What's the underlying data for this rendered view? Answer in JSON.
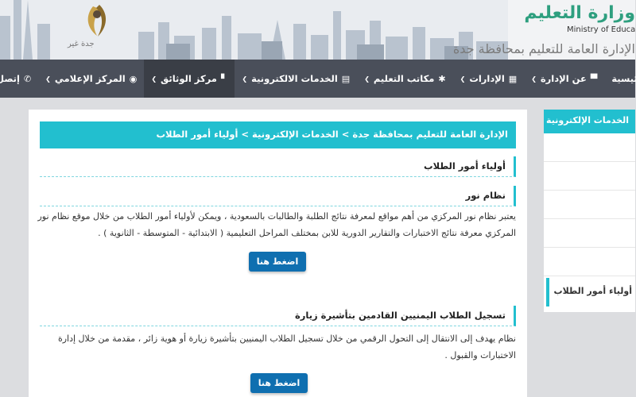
{
  "header": {
    "brand_ar": "وزارة التعليم",
    "brand_en": "Ministry of Education",
    "subtitle_ar": "الإدارة العامة للتعليم بمحافظة جدة",
    "seal_text": "جدة غير"
  },
  "nav": {
    "items": [
      {
        "label": "الرئيسية",
        "icon": "home-icon"
      },
      {
        "label": "عن الإدارة",
        "icon": "monitor-icon"
      },
      {
        "label": "الإدارات",
        "icon": "grid-icon"
      },
      {
        "label": "مكاتب التعليم",
        "icon": "gear-icon"
      },
      {
        "label": "الخدمات الالكترونية",
        "icon": "list-icon"
      },
      {
        "label": "مركز الوثائق",
        "icon": "document-icon"
      },
      {
        "label": "المركز الإعلامي",
        "icon": "eye-icon"
      },
      {
        "label": "إتصل بنا",
        "icon": "phone-icon"
      }
    ]
  },
  "main": {
    "breadcrumb": "الإدارة العامة للتعليم بمحافظة جدة > الخدمات الإلكترونية > أولياء أمور الطلاب",
    "page_heading": "أولياء أمور الطلاب",
    "sections": [
      {
        "title": "نظام نور",
        "body": "يعتبر نظام نور المركزي من أهم مواقع لمعرفة نتائج الطلبة والطالبات بالسعودية ، ويمكن لأولياء أمور الطلاب من خلال موقع نظام نور المركزي معرفة نتائج الاختبارات والتقارير الدورية للابن بمختلف المراحل التعليمية ( الابتدائية - المتوسطة - الثانوية ) .",
        "button": "اضغط هنا"
      },
      {
        "title": "تسجيل الطلاب اليمنيين القادمين بتأشيرة زيارة",
        "body": "نظام يهدف إلى الانتقال إلى التحول الرقمي من خلال تسجيل الطلاب اليمنيين بتأشيرة زيارة أو هوية زائر ، مقدمة من خلال إدارة الاختبارات والقبول .",
        "button": "اضغط هنا"
      }
    ]
  },
  "sidebar": {
    "heading": "الخدمات الإلكترونية",
    "active_item": "أولياء أمور الطلاب"
  },
  "colors": {
    "accent": "#22bfcf",
    "navbar": "#4a4f5a",
    "button": "#0f6fb0",
    "brand": "#2e9f7f"
  }
}
